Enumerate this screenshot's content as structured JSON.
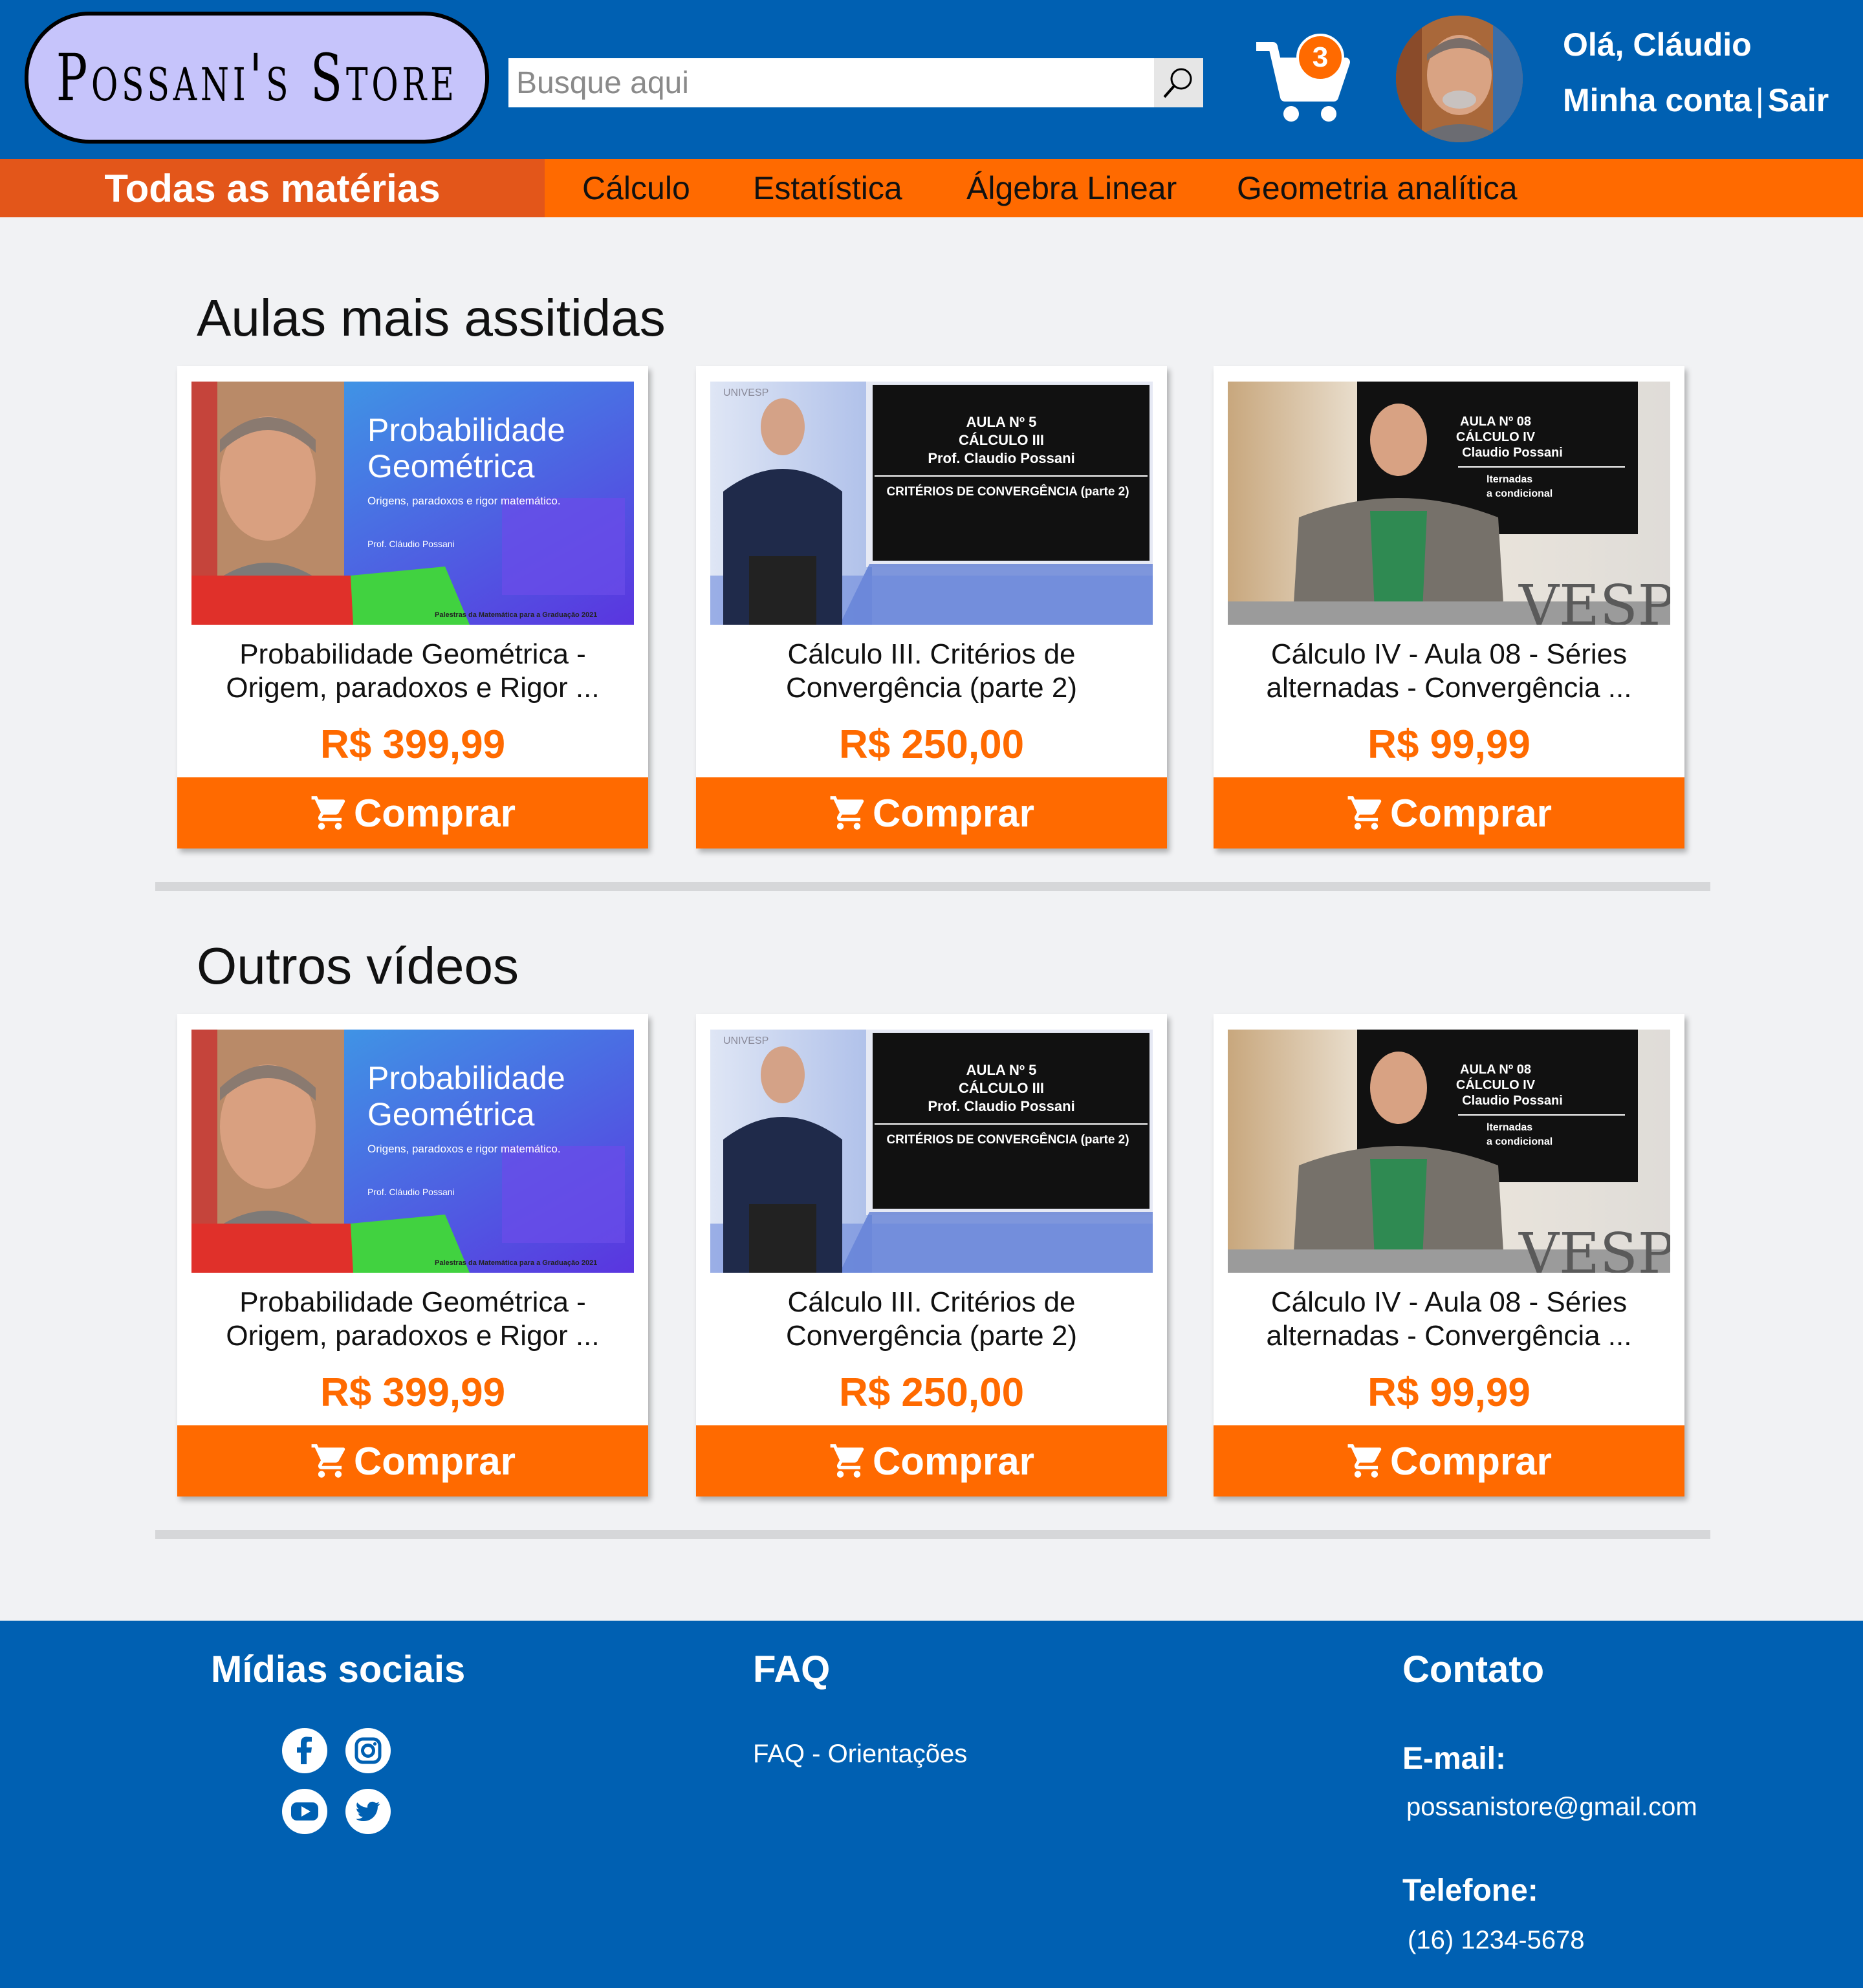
{
  "header": {
    "logo": "Possani's Store",
    "search_placeholder": "Busque aqui",
    "cart_count": "3",
    "greeting": "Olá, Cláudio",
    "account_label": "Minha conta",
    "separator": "|",
    "logout_label": "Sair"
  },
  "nav": {
    "all": "Todas as matérias",
    "items": [
      "Cálculo",
      "Estatística",
      "Álgebra Linear",
      "Geometria analítica"
    ]
  },
  "sections": [
    {
      "title": "Aulas mais assitidas",
      "cards": [
        {
          "title1": "Probabilidade Geométrica -",
          "title2": "Origem, paradoxos e Rigor ...",
          "price": "R$ 399,99",
          "button": "Comprar"
        },
        {
          "title1": "Cálculo III. Critérios de",
          "title2": "Convergência (parte 2)",
          "price": "R$ 250,00",
          "button": "Comprar"
        },
        {
          "title1": "Cálculo IV - Aula 08 - Séries",
          "title2": "alternadas - Convergência ...",
          "price": "R$ 99,99",
          "button": "Comprar"
        }
      ]
    },
    {
      "title": "Outros vídeos",
      "cards": [
        {
          "title1": "Probabilidade Geométrica -",
          "title2": "Origem, paradoxos e Rigor ...",
          "price": "R$ 399,99",
          "button": "Comprar"
        },
        {
          "title1": "Cálculo III. Critérios de",
          "title2": "Convergência (parte 2)",
          "price": "R$ 250,00",
          "button": "Comprar"
        },
        {
          "title1": "Cálculo IV - Aula 08 - Séries",
          "title2": "alternadas - Convergência ...",
          "price": "R$ 99,99",
          "button": "Comprar"
        }
      ]
    }
  ],
  "thumbnails": {
    "prob": {
      "title1": "Probabilidade",
      "title2": "Geométrica",
      "subtitle": "Origens, paradoxos e rigor matemático.",
      "author": "Prof. Cláudio Possani",
      "footer": "Palestras da Matemática para a Graduação 2021"
    },
    "calc3": {
      "line1": "AULA Nº 5",
      "line2": "CÁLCULO  III",
      "line3": "Prof. Claudio Possani",
      "line4": "CRITÉRIOS DE CONVERGÊNCIA (parte 2)",
      "brand": "UNIVESP"
    },
    "calc4": {
      "line1": "AULA Nº 08",
      "line2": "CÁLCULO  IV",
      "line3": "Claudio Possani",
      "line4": "lternadas",
      "line5": "a condicional",
      "brand": "VESP"
    }
  },
  "footer": {
    "social_title": "Mídias sociais",
    "social_icons": [
      "facebook-icon",
      "instagram-icon",
      "youtube-icon",
      "twitter-icon"
    ],
    "faq_title": "FAQ",
    "faq_link": "FAQ - Orientações",
    "contact_title": "Contato",
    "email_label": "E-mail:",
    "email": "possanistore@gmail.com",
    "phone_label": "Telefone:",
    "phone": "(16) 1234-5678"
  },
  "colors": {
    "primary_blue": "#0060b2",
    "accent_orange": "#ff6a00",
    "nav_dark_orange": "#e3561a",
    "logo_bg": "#c6c4fb"
  }
}
